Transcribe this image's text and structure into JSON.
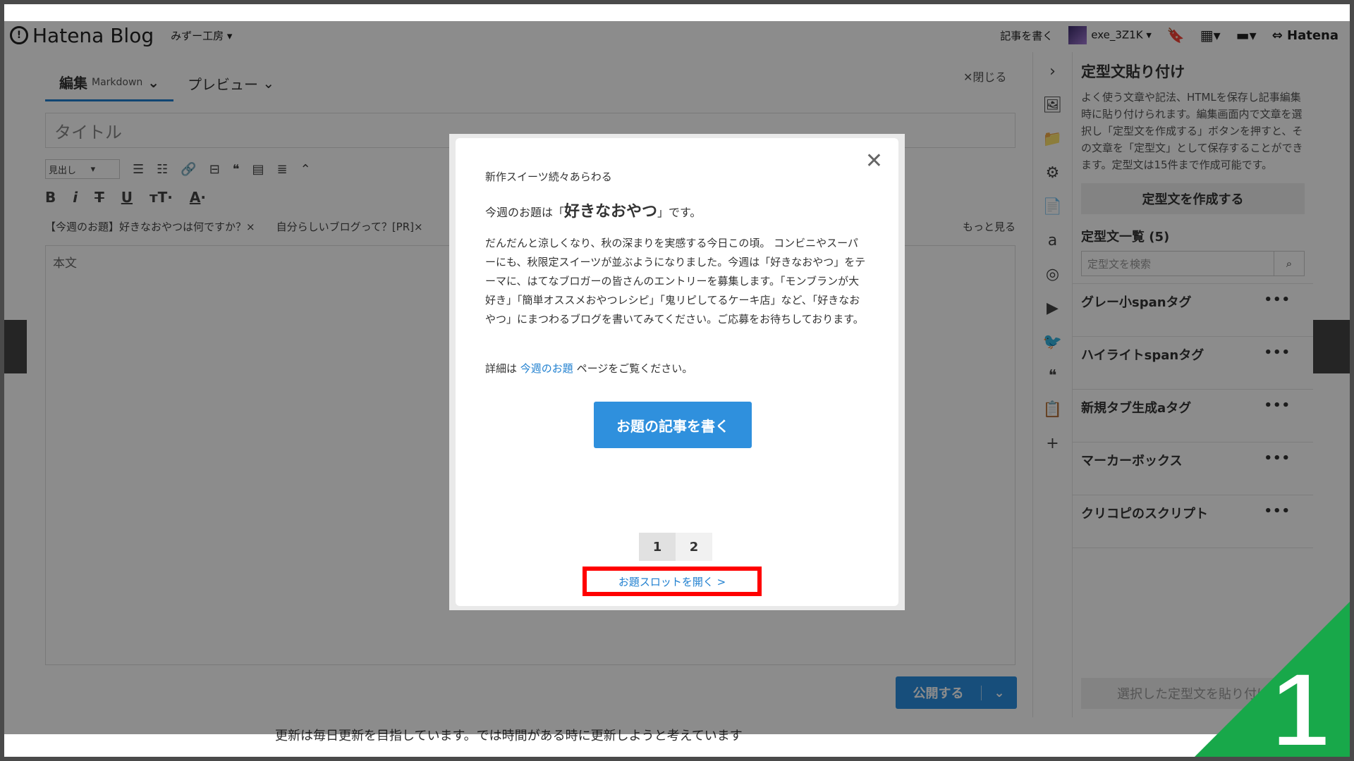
{
  "globalbar": {
    "logo_text": "Hatena Blog",
    "blog_name": "みずー工房",
    "write_article": "記事を書く",
    "user_name": "exe_3Z1K",
    "hatena_text": "Hatena"
  },
  "editor": {
    "tab_edit": "編集",
    "tab_edit_mode": "Markdown",
    "tab_preview": "プレビュー",
    "close_label": "✕閉じる",
    "title_placeholder": "タイトル",
    "heading_select": "見出し",
    "tags": [
      "【今週のお題】好きなおやつは何ですか？×",
      "自分らしいブログって？[PR]×"
    ],
    "more_label": "もっと見る",
    "body_placeholder": "本文",
    "publish_label": "公開する"
  },
  "panel": {
    "title": "定型文貼り付け",
    "description": "よく使う文章や記法、HTMLを保存し記事編集時に貼り付けられます。編集画面内で文章を選択し「定型文を作成する」ボタンを押すと、その文章を「定型文」として保存することができます。定型文は15件まで作成可能です。",
    "create_button": "定型文を作成する",
    "list_title": "定型文一覧 (5)",
    "search_placeholder": "定型文を検索",
    "items": [
      "グレー小spanタグ",
      "ハイライトspanタグ",
      "新規タブ生成aタグ",
      "マーカーボックス",
      "クリコピのスクリプト"
    ],
    "paste_button": "選択した定型文を貼り付け"
  },
  "modal": {
    "eyebrow": "新作スイーツ続々あらわる",
    "theme_prefix": "今週のお題は「",
    "theme_name": "好きなおやつ",
    "theme_suffix": "」です。",
    "body": "だんだんと涼しくなり、秋の深まりを実感する今日この頃。 コンビニやスーパーにも、秋限定スイーツが並ぶようになりました。今週は「好きなおやつ」をテーマに、はてなブロガーの皆さんのエントリーを募集します。「モンブランが大好き」「簡単オススメおやつレシピ」「鬼リピしてるケーキ店」など、「好きなおやつ」にまつわるブログを書いてみてください。ご応募をお待ちしております。",
    "detail_prefix": "詳細は ",
    "detail_link": "今週のお題",
    "detail_suffix": " ページをご覧ください。",
    "cta": "お題の記事を書く",
    "pages": [
      "1",
      "2"
    ],
    "slot_link": "お題スロットを開く >"
  },
  "background": {
    "bottom_text": "更新は毎日更新を目指しています。では時間がある時に更新しようと考えています"
  },
  "step_number": "1",
  "colors": {
    "accent": "#2f90dd",
    "highlight": "#ff0000",
    "badge": "#18a84a"
  }
}
